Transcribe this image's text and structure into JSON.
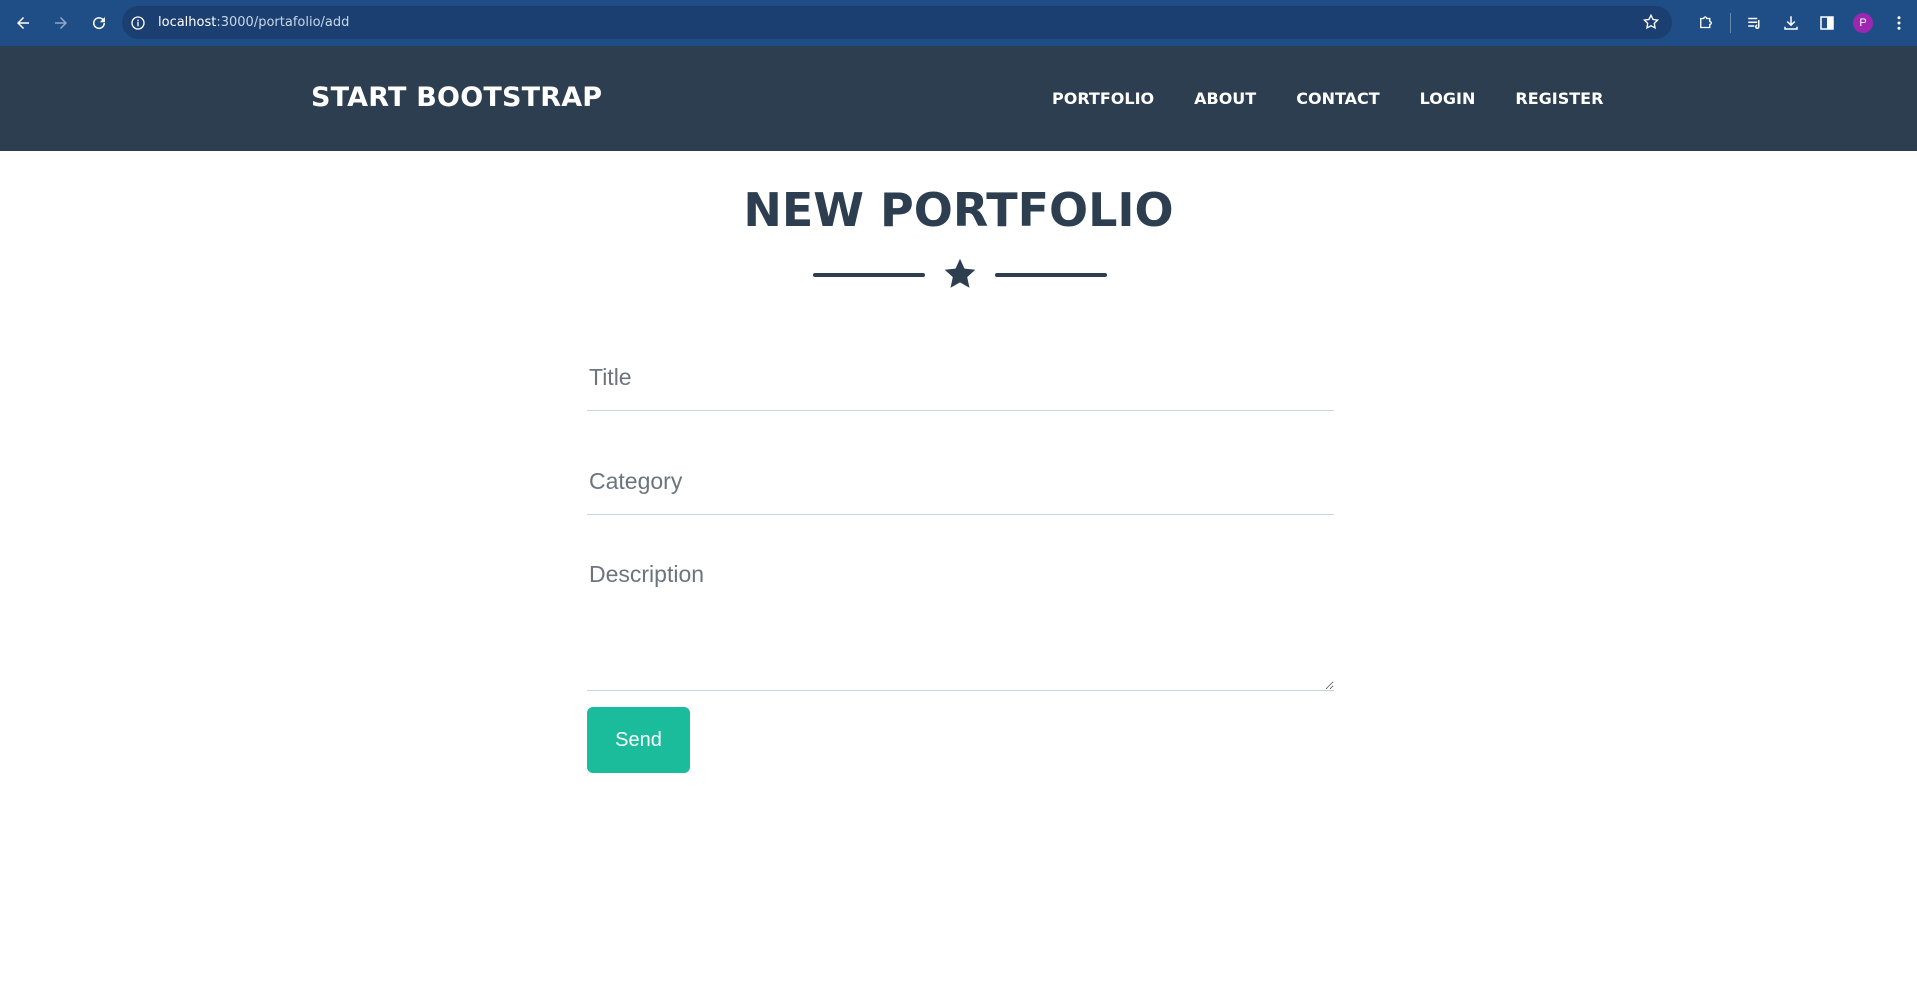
{
  "browser": {
    "url_host": "localhost",
    "url_path": ":3000/portafolio/add",
    "avatar_letter": "P",
    "icons": [
      "back-arrow-icon",
      "forward-arrow-icon",
      "reload-icon",
      "info-icon",
      "bookmark-star-icon",
      "extensions-icon",
      "reading-list-icon",
      "download-icon",
      "side-panel-icon",
      "more-menu-icon"
    ]
  },
  "navbar": {
    "brand": "START BOOTSTRAP",
    "links": [
      "PORTFOLIO",
      "ABOUT",
      "CONTACT",
      "LOGIN",
      "REGISTER"
    ]
  },
  "page": {
    "title": "NEW PORTFOLIO"
  },
  "form": {
    "title_placeholder": "Title",
    "category_placeholder": "Category",
    "description_placeholder": "Description",
    "submit_label": "Send"
  },
  "colors": {
    "navbar_bg": "#2c3e50",
    "accent": "#1abc9c",
    "browser_bar": "#1f4e86"
  }
}
